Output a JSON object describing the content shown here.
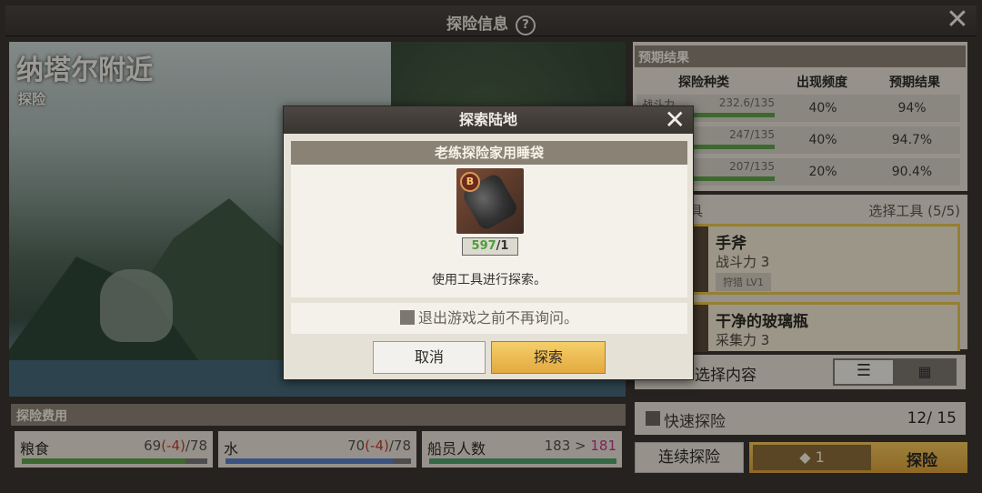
{
  "window": {
    "title": "探险信息",
    "help_icon": "?",
    "close_icon": "✕"
  },
  "location": {
    "name": "纳塔尔附近",
    "type": "探险"
  },
  "expected": {
    "header": "预期结果",
    "columns": [
      "探险种类",
      "出现频度",
      "预期结果"
    ],
    "rows": [
      {
        "kind": "战斗力",
        "power": "232.6/135",
        "progress": 1.0,
        "freq": "40%",
        "result": "94%"
      },
      {
        "kind": "",
        "power": "247/135",
        "progress": 1.0,
        "freq": "40%",
        "result": "94.7%"
      },
      {
        "kind": "",
        "power": "207/135",
        "progress": 1.0,
        "freq": "20%",
        "result": "90.4%"
      }
    ]
  },
  "tools": {
    "header_left": "具",
    "header_right": "选择工具 (5/5)",
    "items": [
      {
        "name": "手斧",
        "stat": "战斗力 3",
        "tag": "狩猎 LV1"
      },
      {
        "name": "干净的玻璃瓶",
        "stat": "采集力 3",
        "tag": ""
      }
    ]
  },
  "select_content": {
    "label": "选择内容",
    "list_icon": "☰",
    "grid_icon": "▦"
  },
  "quick": {
    "label": "快速探险",
    "count": "12/ 15"
  },
  "buttons": {
    "continuous": "连续探险",
    "ticket_count": "1",
    "explore": "探险"
  },
  "cost": {
    "header": "探险费用",
    "items": [
      {
        "label": "粮食",
        "current": "69",
        "delta": "(-4)",
        "max": "/78",
        "fill": 0.88,
        "color": "#5fa04a"
      },
      {
        "label": "水",
        "current": "70",
        "delta": "(-4)",
        "max": "/78",
        "fill": 0.9,
        "color": "#5a7ec8"
      },
      {
        "label": "船员人数",
        "current": "183 > ",
        "delta": "181",
        "max": "",
        "fill": 1.0,
        "color": "#4fa26a"
      }
    ]
  },
  "modal": {
    "title": "探索陆地",
    "item_name": "老练探险家用睡袋",
    "badge": "B",
    "have": "597",
    "need": "/1",
    "hint": "使用工具进行探索。",
    "dont_ask": "退出游戏之前不再询问。",
    "cancel": "取消",
    "confirm": "探索"
  },
  "colors": {
    "accent_gold": "#e5c44c",
    "header_brown": "#8b8276",
    "negative": "#c43a2b",
    "positive": "#4f9d3c"
  }
}
